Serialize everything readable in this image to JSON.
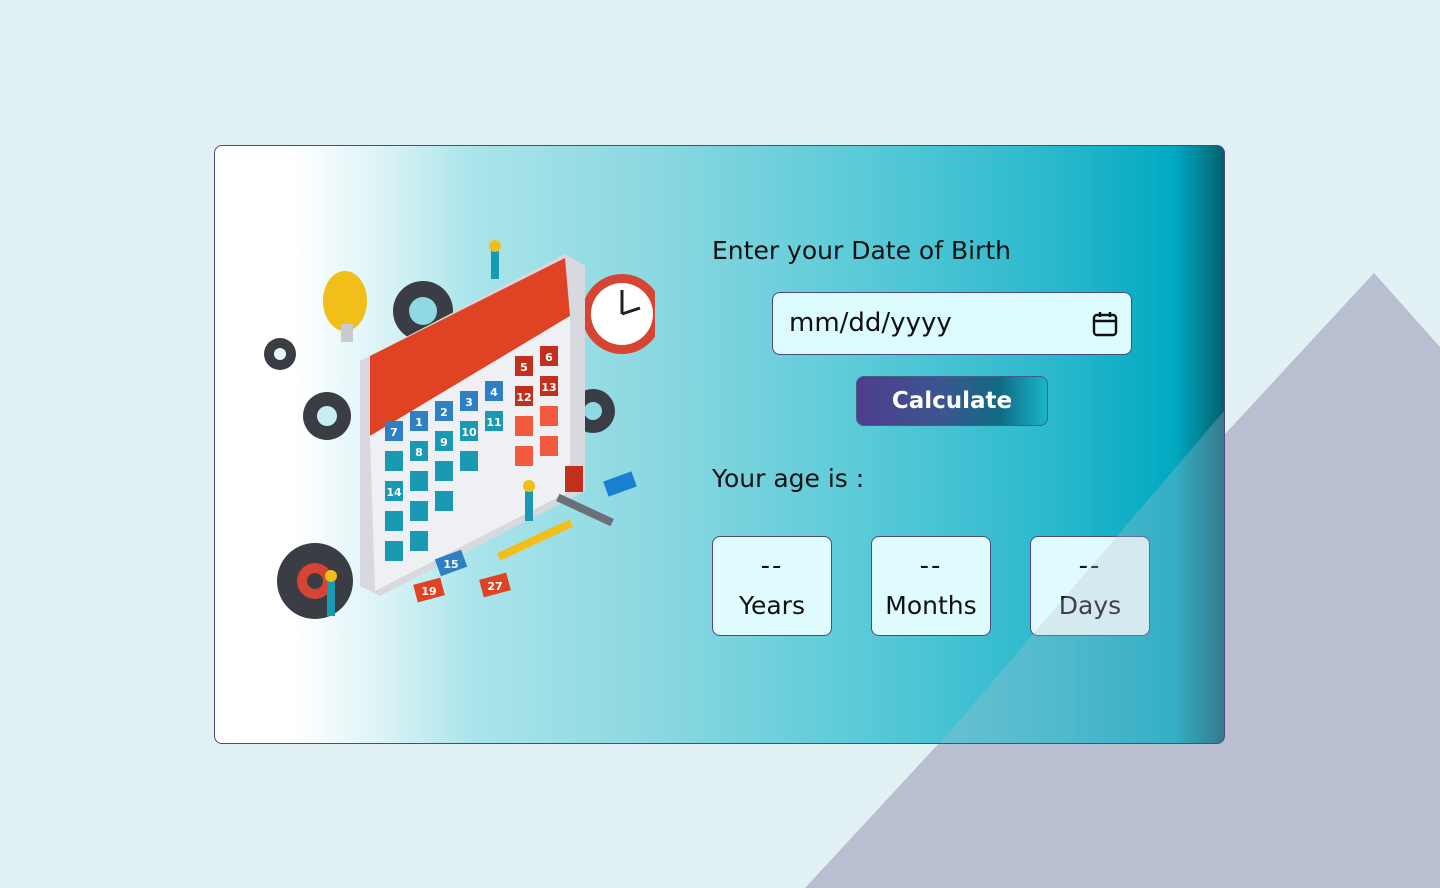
{
  "colors": {
    "page_background": "#e2f1f3",
    "triangle": "#b9bfd1",
    "card_border": "#4b4a86",
    "input_background": "#dcfbfd",
    "button_start": "#4f3d8e",
    "button_end": "#19b6c6"
  },
  "form": {
    "dob_label": "Enter your Date of Birth",
    "dob_placeholder": "mm/dd/yyyy",
    "calendar_icon": "calendar-icon",
    "calculate_label": "Calculate"
  },
  "result": {
    "label": "Your age is :",
    "years": {
      "value": "--",
      "unit": "Years"
    },
    "months": {
      "value": "--",
      "unit": "Months"
    },
    "days": {
      "value": "--",
      "unit": "Days"
    }
  },
  "illustration": {
    "icon": "calendar-gears-illustration",
    "day_numbers": [
      "1",
      "2",
      "3",
      "4",
      "5",
      "6",
      "7",
      "8",
      "9",
      "10",
      "11",
      "12",
      "13",
      "14",
      "15",
      "19",
      "27"
    ]
  }
}
